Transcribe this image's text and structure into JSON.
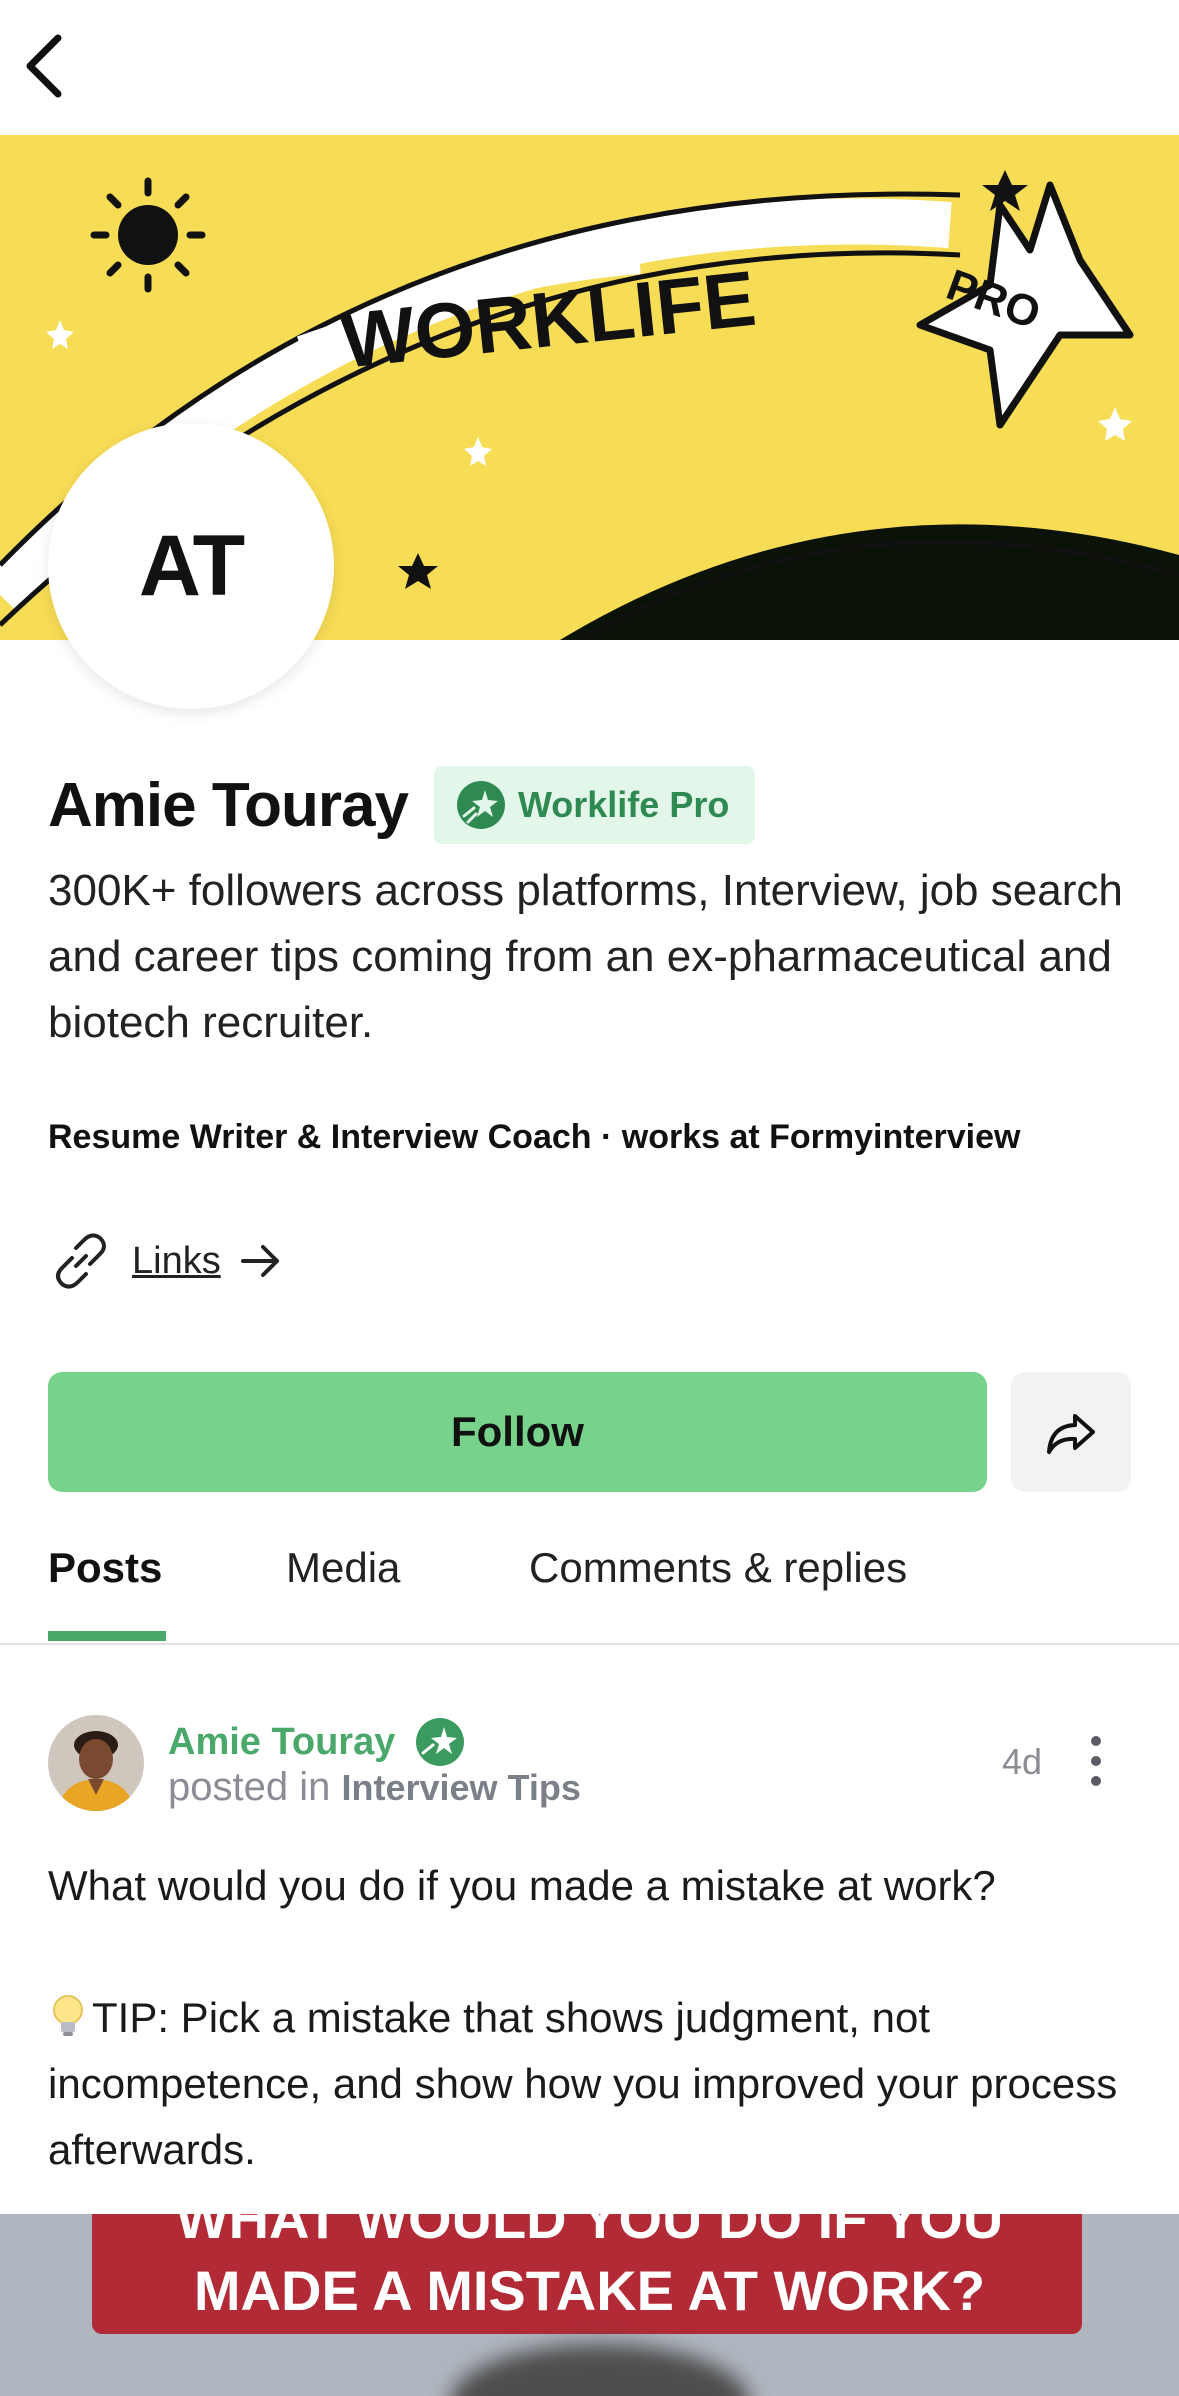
{
  "banner": {
    "title": "WORKLIFE",
    "badge_text": "PRO"
  },
  "profile": {
    "initials": "AT",
    "name": "Amie Touray",
    "badge_label": "Worklife Pro",
    "bio": "300K+ followers across platforms, Interview, job search and career tips coming from an ex-pharmaceutical and biotech recruiter.",
    "role_line": "Resume Writer & Interview Coach · works at  Formyinterview",
    "links_label": "Links"
  },
  "actions": {
    "follow_label": "Follow"
  },
  "tabs": [
    {
      "label": "Posts",
      "active": true
    },
    {
      "label": "Media",
      "active": false
    },
    {
      "label": "Comments & replies",
      "active": false
    }
  ],
  "post": {
    "author": "Amie Touray",
    "posted_in_prefix": "posted in",
    "community": "Interview Tips",
    "time": "4d",
    "text_line1": "What would you do if you made a mistake at work?",
    "tip_text": "TIP: Pick a mistake that shows judgment, not incompetence, and show how you improved your process afterwards.",
    "image_line1": "WHAT WOULD YOU DO IF YOU",
    "image_line2": "MADE A MISTAKE AT WORK?"
  },
  "colors": {
    "banner_yellow": "#f7dc55",
    "follow_green": "#77d38c",
    "brand_green": "#49a96a",
    "badge_bg": "#e3f6ea"
  },
  "icons": {
    "back": "chevron-left-icon",
    "link": "link-icon",
    "arrow": "arrow-right-icon",
    "share": "share-icon",
    "pro": "worklife-pro-icon",
    "more": "more-vertical-icon",
    "tip": "lightbulb-icon"
  }
}
